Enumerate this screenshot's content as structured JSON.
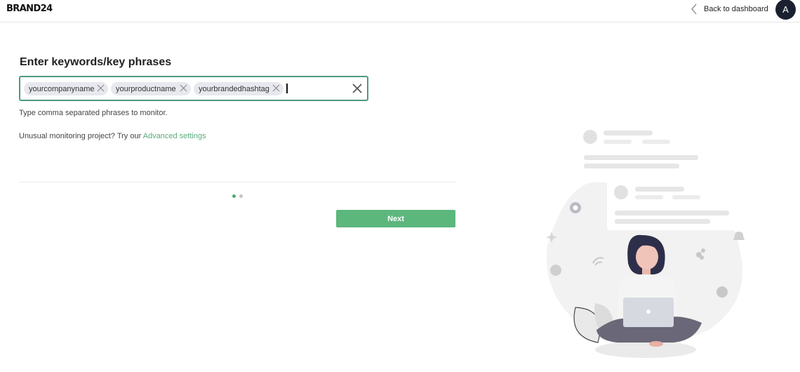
{
  "header": {
    "logo": "BRAND24",
    "back_label": "Back to dashboard",
    "avatar_initial": "A"
  },
  "form": {
    "title": "Enter keywords/key phrases",
    "keywords": [
      "yourcompanyname",
      "yourproductname",
      "yourbrandedhashtag"
    ],
    "input_value": "",
    "hint": "Type comma separated phrases to monitor.",
    "unusual_prefix": "Unusual monitoring project? Try our",
    "advanced_link": "Advanced settings",
    "next_label": "Next"
  },
  "pagination": {
    "current_step": 1,
    "total_steps": 2
  },
  "colors": {
    "accent": "#5cb77d",
    "input_border": "#4f9a7f",
    "link": "#5aa97a",
    "chip_bg": "#e7e9ee",
    "avatar_bg": "#1b2030"
  }
}
